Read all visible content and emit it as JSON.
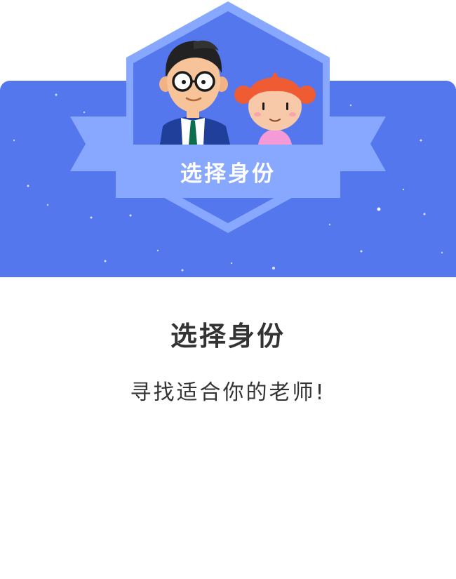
{
  "header": {
    "badge_label": "选择身份"
  },
  "main": {
    "title": "选择身份",
    "subtitle": "寻找适合你的老师!"
  },
  "colors": {
    "banner": "#5577ee",
    "ribbon": "#88a8ff",
    "text": "#333333"
  },
  "icons": [
    "teacher-avatar-icon",
    "student-avatar-icon"
  ]
}
